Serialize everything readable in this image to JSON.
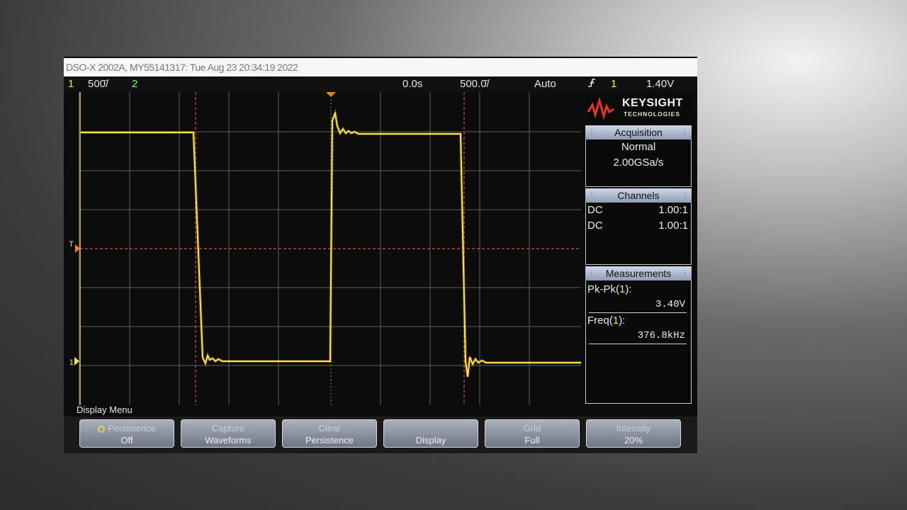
{
  "title_bar": {
    "text": "DSO-X 2002A, MY55141317: Tue Aug 23 20:34:19 2022"
  },
  "status_bar": {
    "ch1_label": "1",
    "ch1_scale": "500̄/",
    "ch2_label": "2",
    "delay": "0.0s",
    "timebase": "500.0̄/",
    "trigger_mode": "Auto",
    "trigger_icon": "edge-trigger-icon",
    "trigger_source": "1",
    "trigger_level": "1.40V"
  },
  "brand": {
    "name": "KEYSIGHT",
    "sub": "TECHNOLOGIES"
  },
  "acquisition": {
    "header": "Acquisition",
    "mode": "Normal",
    "rate": "2.00GSa/s"
  },
  "channels": {
    "header": "Channels",
    "items": [
      {
        "coupling": "DC",
        "probe": "1.00:1",
        "color": "#ffe14d"
      },
      {
        "coupling": "DC",
        "probe": "1.00:1",
        "color": "#7cff7c"
      }
    ]
  },
  "measurements": {
    "header": "Measurements",
    "items": [
      {
        "label_prefix": "Pk-Pk(",
        "label_channel": "1",
        "label_suffix": "):",
        "value": "3.40V"
      },
      {
        "label_prefix": "Freq(",
        "label_channel": "1",
        "label_suffix": "):",
        "value": "376.8kHz"
      }
    ]
  },
  "menu": {
    "title": "Display Menu"
  },
  "softkeys": [
    {
      "line1": "Persistence",
      "line2": "Off"
    },
    {
      "line1": "Capture",
      "line2": "Waveforms"
    },
    {
      "line1": "Clear",
      "line2": "Persistence"
    },
    {
      "line1": "",
      "line2": "Display"
    },
    {
      "line1": "Grid",
      "line2": "Full"
    },
    {
      "line1": "Intensity",
      "line2": "20%"
    }
  ],
  "waveform_markers": {
    "channel_marker": "1",
    "trigger_marker": "T"
  },
  "colors": {
    "ch1": "#ffe14d",
    "ch2": "#7cff7c",
    "cursor": "#ff5a3c",
    "grid": "#6e6e6e"
  }
}
